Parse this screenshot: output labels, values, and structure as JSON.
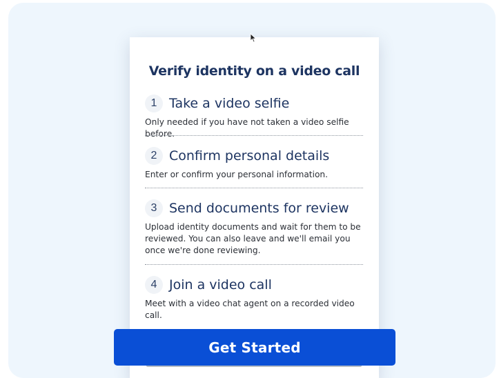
{
  "card": {
    "title": "Verify identity on a video call",
    "steps": [
      {
        "number": "1",
        "title": "Take a video selfie",
        "description": "Only needed if you have not taken a video selfie before."
      },
      {
        "number": "2",
        "title": "Confirm personal details",
        "description": "Enter or confirm your personal information."
      },
      {
        "number": "3",
        "title": "Send documents for review",
        "description": "Upload identity documents and wait for them to be reviewed. You can also leave and we'll email you once we're done reviewing."
      },
      {
        "number": "4",
        "title": "Join a video call",
        "description": "Meet with a video chat agent on a recorded video call."
      }
    ]
  },
  "cta": {
    "label": "Get Started",
    "color": "#0a4fd6"
  },
  "colors": {
    "background": "#eef6fd",
    "heading": "#1d3461"
  },
  "icons": {
    "cursor": "mouse-pointer-icon"
  }
}
